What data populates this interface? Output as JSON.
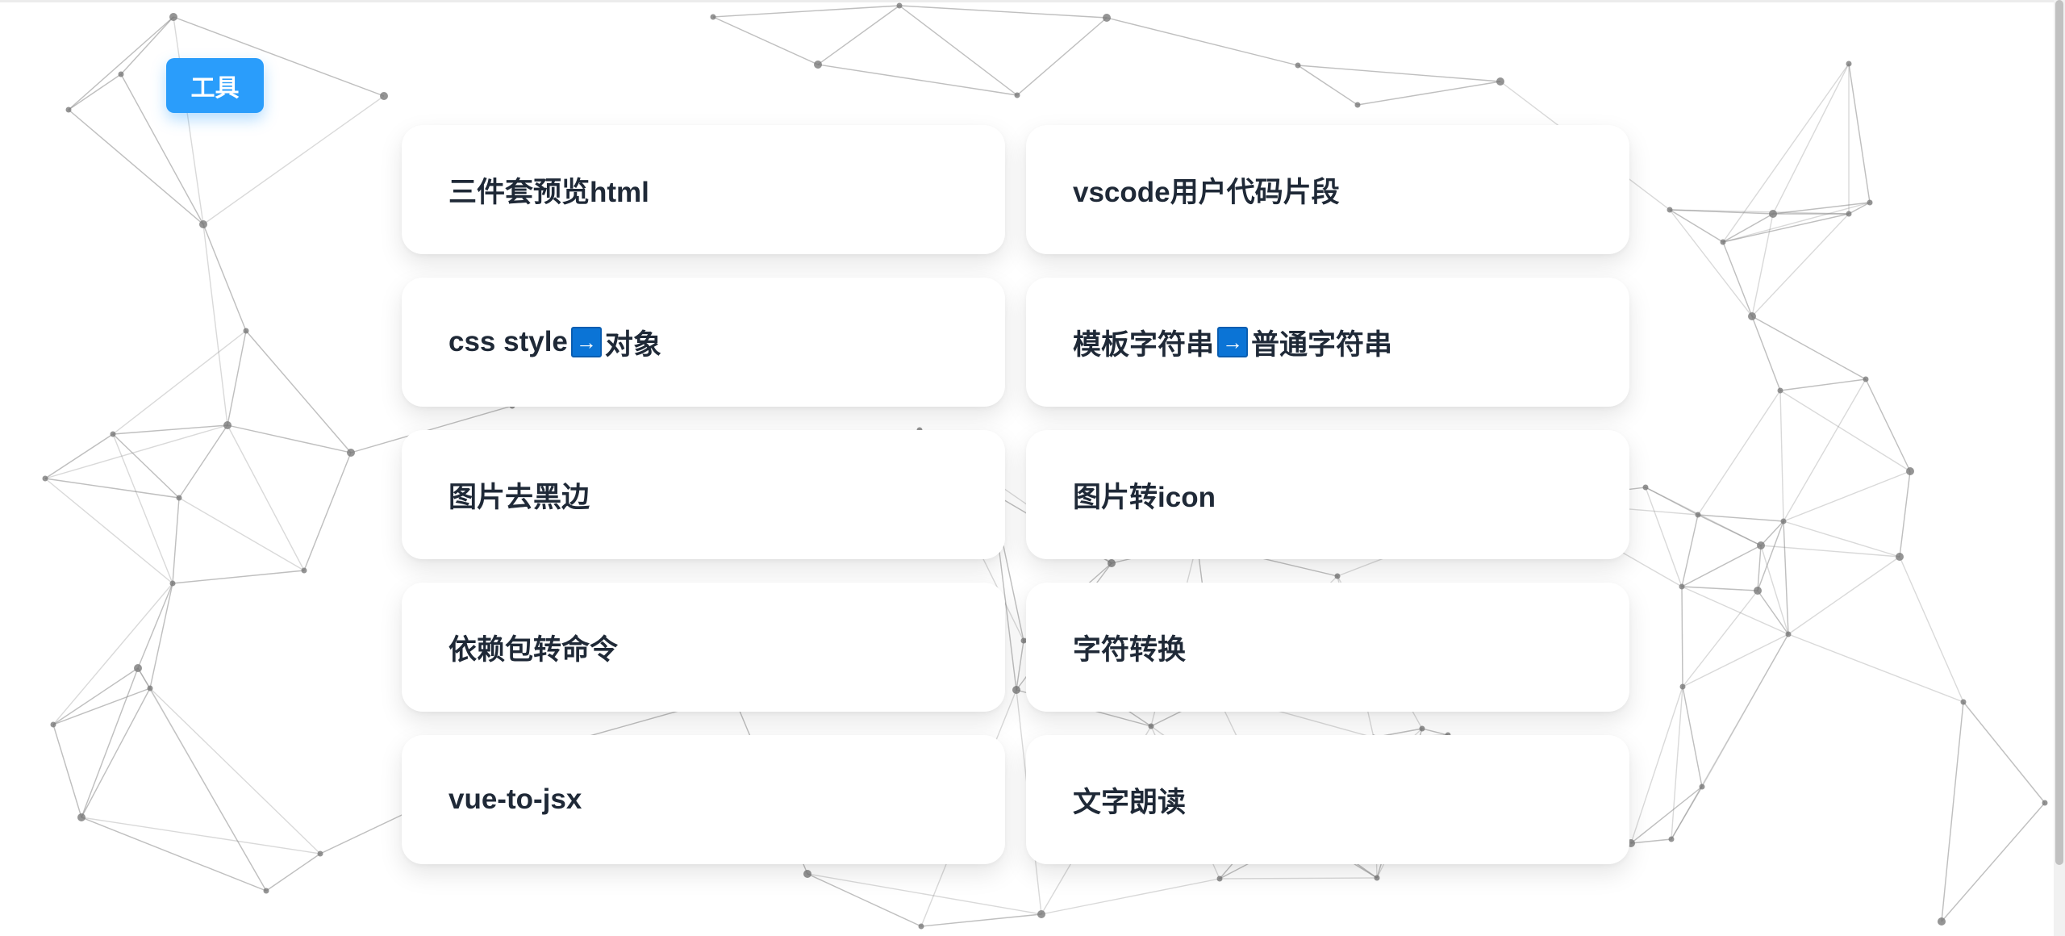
{
  "header": {
    "tools_label": "工具"
  },
  "tools": [
    {
      "parts": [
        "三件套预览html"
      ]
    },
    {
      "parts": [
        "vscode用户代码片段"
      ]
    },
    {
      "parts": [
        "css style",
        "对象"
      ],
      "icon": "right-arrow-icon"
    },
    {
      "parts": [
        "模板字符串",
        "普通字符串"
      ],
      "icon": "right-arrow-icon"
    },
    {
      "parts": [
        "图片去黑边"
      ]
    },
    {
      "parts": [
        "图片转icon"
      ]
    },
    {
      "parts": [
        "依赖包转命令"
      ]
    },
    {
      "parts": [
        "字符转换"
      ]
    },
    {
      "parts": [
        "vue-to-jsx"
      ]
    },
    {
      "parts": [
        "文字朗读"
      ]
    }
  ],
  "colors": {
    "accent": "#2a9dfb",
    "arrow_icon": "#0b74d6",
    "text": "#1f2937",
    "network": "#8a8a8a"
  }
}
